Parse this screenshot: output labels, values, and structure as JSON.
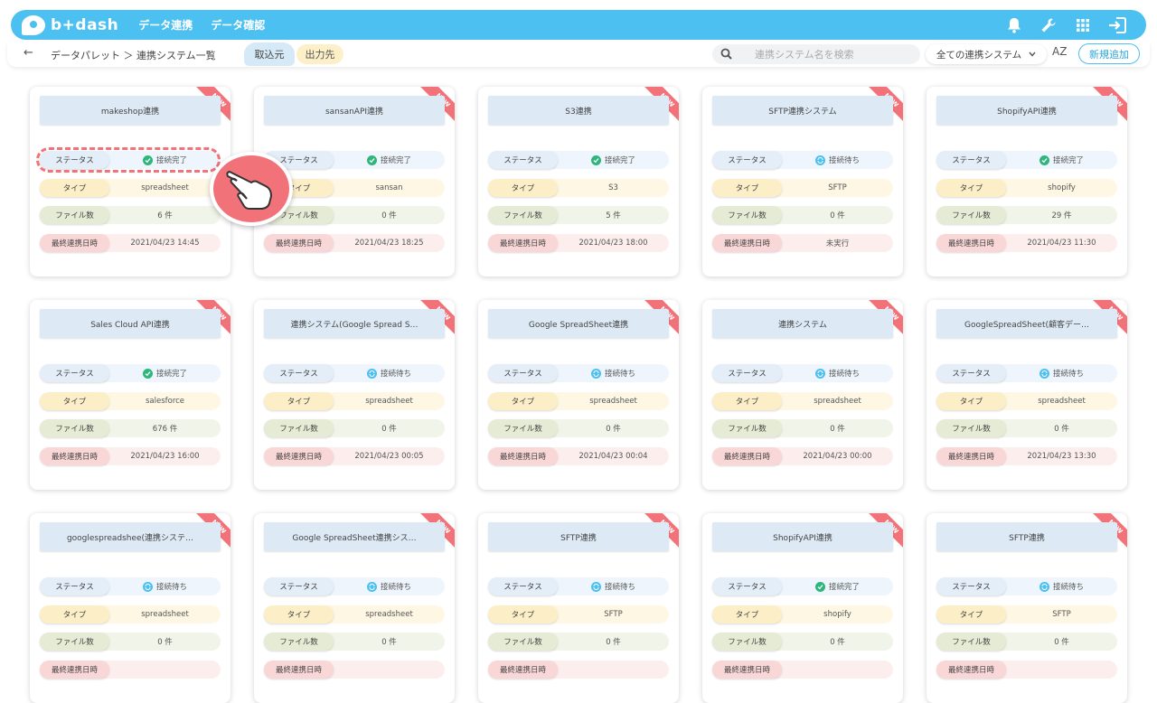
{
  "app": {
    "logo": "b+dash"
  },
  "topnav": {
    "items": [
      "データ連携",
      "データ確認"
    ]
  },
  "subbar": {
    "breadcrumb": "データパレット ＞ 連携システム一覧",
    "tab_in": "取込元",
    "tab_out": "出力先",
    "search_placeholder": "連携システム名を検索",
    "filter": "全ての連携システム",
    "sort": "AZ",
    "add_button": "新規追加"
  },
  "labels": {
    "status": "ステータス",
    "type": "タイプ",
    "files": "ファイル数",
    "date": "最終連携日時",
    "new": "NEW"
  },
  "colors": {
    "accent": "#4cc0f0",
    "new_ribbon": "#f2727a",
    "ok": "#2eb67d"
  },
  "cards": [
    {
      "title": "makeshop連携",
      "status": "接続完了",
      "status_kind": "ok",
      "type": "spreadsheet",
      "files": "6 件",
      "date": "2021/04/23 14:45"
    },
    {
      "title": "sansanAPI連携",
      "status": "接続完了",
      "status_kind": "ok",
      "type": "sansan",
      "files": "0 件",
      "date": "2021/04/23 18:25"
    },
    {
      "title": "S3連携",
      "status": "接続完了",
      "status_kind": "ok",
      "type": "S3",
      "files": "5 件",
      "date": "2021/04/23 18:00"
    },
    {
      "title": "SFTP連携システム",
      "status": "接続待ち",
      "status_kind": "wait",
      "type": "SFTP",
      "files": "0 件",
      "date": "未実行"
    },
    {
      "title": "ShopifyAPI連携",
      "status": "接続完了",
      "status_kind": "ok",
      "type": "shopify",
      "files": "29 件",
      "date": "2021/04/23 11:30"
    },
    {
      "title": "Sales Cloud API連携",
      "status": "接続完了",
      "status_kind": "ok",
      "type": "salesforce",
      "files": "676 件",
      "date": "2021/04/23 16:00"
    },
    {
      "title": "連携システム(Google Spread S…",
      "status": "接続待ち",
      "status_kind": "wait",
      "type": "spreadsheet",
      "files": "0 件",
      "date": "2021/04/23 00:05"
    },
    {
      "title": "Google SpreadSheet連携",
      "status": "接続待ち",
      "status_kind": "wait",
      "type": "spreadsheet",
      "files": "0 件",
      "date": "2021/04/23 00:04"
    },
    {
      "title": "連携システム",
      "status": "接続待ち",
      "status_kind": "wait",
      "type": "spreadsheet",
      "files": "0 件",
      "date": "2021/04/23 00:00"
    },
    {
      "title": "GoogleSpreadSheet(顧客デー…",
      "status": "接続待ち",
      "status_kind": "wait",
      "type": "spreadsheet",
      "files": "0 件",
      "date": "2021/04/23 13:30"
    },
    {
      "title": "googlespreadshee(連携システ…",
      "status": "接続待ち",
      "status_kind": "wait",
      "type": "spreadsheet",
      "files": "0 件",
      "date": ""
    },
    {
      "title": "Google SpreadSheet連携シス…",
      "status": "接続待ち",
      "status_kind": "wait",
      "type": "spreadsheet",
      "files": "0 件",
      "date": ""
    },
    {
      "title": "SFTP連携",
      "status": "接続待ち",
      "status_kind": "wait",
      "type": "SFTP",
      "files": "0 件",
      "date": ""
    },
    {
      "title": "ShopifyAPI連携",
      "status": "接続完了",
      "status_kind": "ok",
      "type": "shopify",
      "files": "0 件",
      "date": ""
    },
    {
      "title": "SFTP連携",
      "status": "接続待ち",
      "status_kind": "wait",
      "type": "SFTP",
      "files": "0 件",
      "date": ""
    }
  ]
}
